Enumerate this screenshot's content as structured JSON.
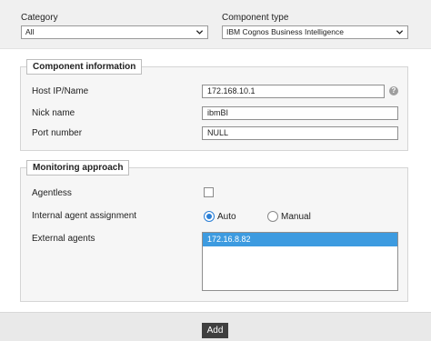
{
  "filters": {
    "category_label": "Category",
    "category_value": "All",
    "component_type_label": "Component type",
    "component_type_value": "IBM Cognos Business Intelligence"
  },
  "component_info": {
    "legend": "Component information",
    "host_label": "Host IP/Name",
    "host_value": "172.168.10.1",
    "nick_label": "Nick name",
    "nick_value": "ibmBI",
    "port_label": "Port number",
    "port_value": "NULL"
  },
  "monitoring": {
    "legend": "Monitoring approach",
    "agentless_label": "Agentless",
    "agentless_checked": false,
    "assignment_label": "Internal agent assignment",
    "auto_label": "Auto",
    "manual_label": "Manual",
    "selected_assignment": "Auto",
    "external_label": "External agents",
    "external_agents": [
      "172.16.8.82"
    ]
  },
  "actions": {
    "add_label": "Add"
  },
  "icons": {
    "chevron": "chevron-down-icon",
    "help": "help-icon"
  },
  "colors": {
    "selection": "#3d9be0",
    "radio_accent": "#2a7fd6",
    "button": "#3f3f3f"
  }
}
